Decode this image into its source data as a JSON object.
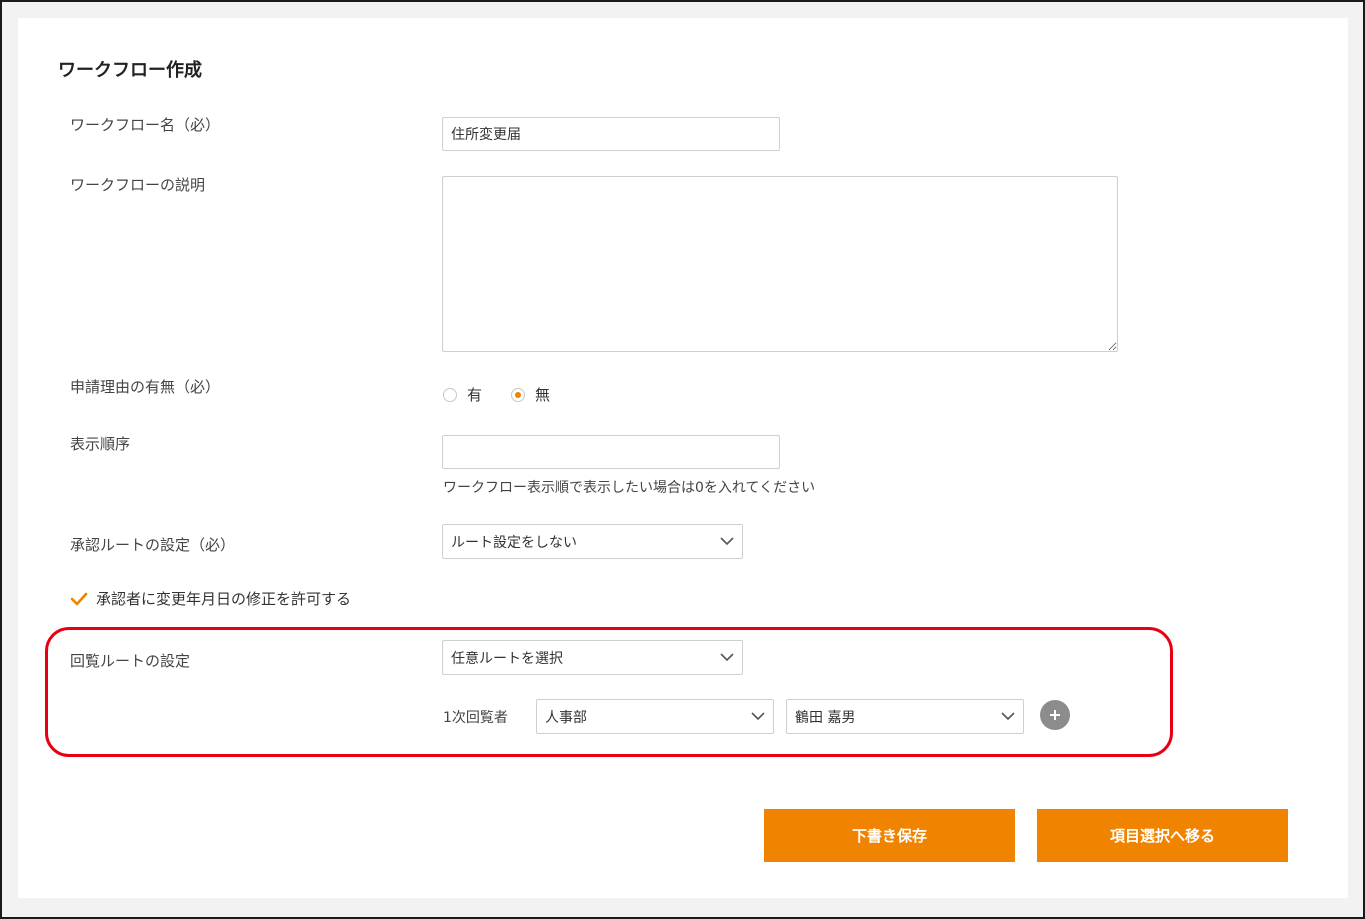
{
  "page": {
    "title": "ワークフロー作成"
  },
  "form": {
    "name_label": "ワークフロー名（必）",
    "name_value": "住所変更届",
    "description_label": "ワークフローの説明",
    "description_value": "",
    "reason_label": "申請理由の有無（必）",
    "reason_options": [
      {
        "label": "有",
        "selected": false
      },
      {
        "label": "無",
        "selected": true
      }
    ],
    "order_label": "表示順序",
    "order_value": "",
    "order_hint": "ワークフロー表示順で表示したい場合は0を入れてください",
    "approval_route_label": "承認ルートの設定（必）",
    "approval_route_value": "ルート設定をしない",
    "allow_date_edit_label": "承認者に変更年月日の修正を許可する",
    "allow_date_edit_checked": true,
    "circulation_route_label": "回覧ルートの設定",
    "circulation_route_value": "任意ルートを選択",
    "reviewer_label": "1次回覧者",
    "reviewer_department": "人事部",
    "reviewer_person": "鶴田 嘉男"
  },
  "buttons": {
    "save_draft": "下書き保存",
    "next": "項目選択へ移る"
  },
  "colors": {
    "accent": "#f08300",
    "highlight_border": "#e60012"
  },
  "icons": {
    "dropdown": "chevron-down-icon",
    "add": "plus-icon",
    "check": "check-icon"
  }
}
